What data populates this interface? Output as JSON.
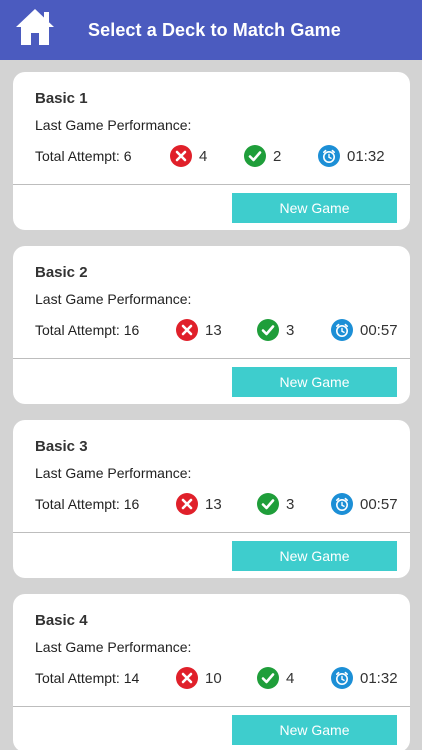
{
  "header": {
    "title": "Select a Deck to Match Game",
    "home_icon": "home-icon",
    "background": "#4b5bbf"
  },
  "labels": {
    "last_game_performance": "Last Game Performance:",
    "new_game": "New Game"
  },
  "colors": {
    "wrong": "#e0202a",
    "correct": "#1f9e3a",
    "time": "#1c8fd6",
    "button": "#3ecdcd"
  },
  "decks": [
    {
      "name": "Basic 1",
      "total_attempt": "Total Attempt: 6",
      "wrong": "4",
      "correct": "2",
      "time": "01:32"
    },
    {
      "name": "Basic 2",
      "total_attempt": "Total Attempt: 16",
      "wrong": "13",
      "correct": "3",
      "time": "00:57"
    },
    {
      "name": "Basic 3",
      "total_attempt": "Total Attempt: 16",
      "wrong": "13",
      "correct": "3",
      "time": "00:57"
    },
    {
      "name": "Basic 4",
      "total_attempt": "Total Attempt: 14",
      "wrong": "10",
      "correct": "4",
      "time": "01:32"
    }
  ]
}
